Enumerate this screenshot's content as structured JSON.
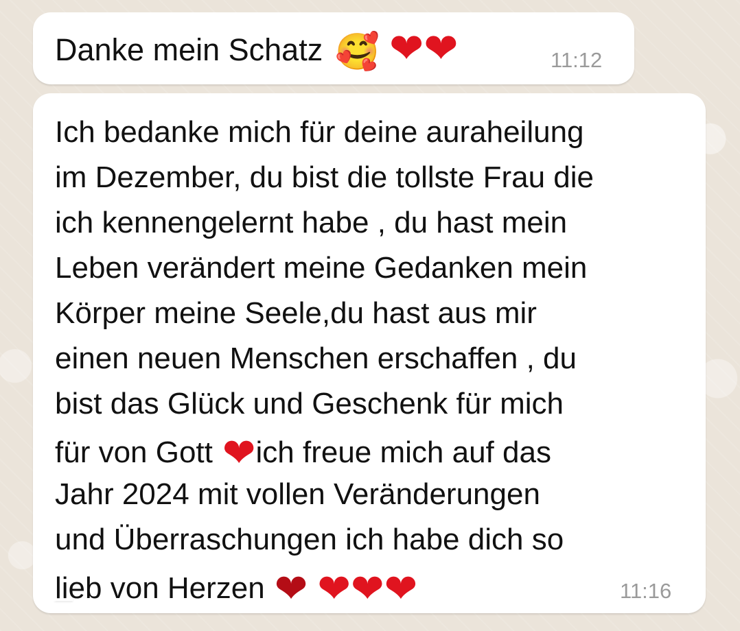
{
  "messages": [
    {
      "text": "Danke mein Schatz",
      "emoji": "🥰",
      "hearts": [
        "❤",
        "❤"
      ],
      "time": "11:12"
    },
    {
      "lines": [
        "Ich bedanke mich für deine auraheilung",
        "im Dezember, du bist die tollste Frau die",
        "ich kennengelernt habe , du hast mein",
        "Leben verändert meine Gedanken mein",
        "Körper meine Seele,du hast aus mir",
        "einen neuen Menschen erschaffen , du",
        "bist das Glück und Geschenk für mich",
        "für von Gott",
        "ich freue mich auf das",
        "Jahr 2024 mit vollen Veränderungen",
        "und Überraschungen ich habe dich so",
        "lieb von Herzen"
      ],
      "time": "11:16",
      "heart_symbol": "❤"
    }
  ]
}
